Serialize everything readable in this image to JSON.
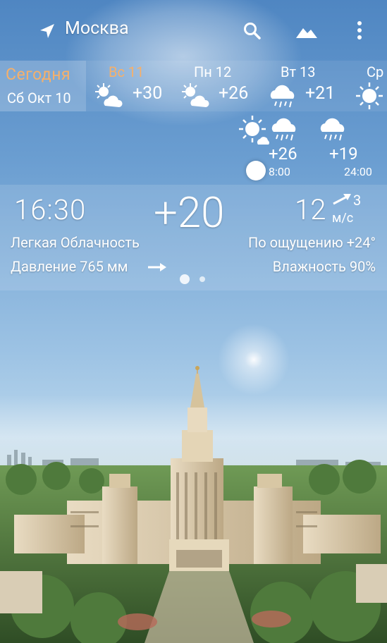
{
  "header": {
    "city": "Москва",
    "location_icon": "location-arrow-icon",
    "search_icon": "search-icon",
    "landscape_icon": "landscape-icon",
    "menu_icon": "more-vert-icon"
  },
  "forecast": {
    "today_label": "Сегодня",
    "today_date": "Сб Окт 10",
    "days": [
      {
        "label": "Вс 11",
        "temp": "+30",
        "icon": "partly-cloudy-icon"
      },
      {
        "label": "Пн 12",
        "temp": "+26",
        "icon": "partly-cloudy-icon"
      },
      {
        "label": "Вт 13",
        "temp": "+21",
        "icon": "rain-icon"
      },
      {
        "label": "Ср",
        "temp": "",
        "icon": "sun-icon"
      }
    ]
  },
  "hourly": [
    {
      "temp": "+26",
      "time": "8:00",
      "icons": [
        "partly-cloudy-icon",
        "rain-icon"
      ]
    },
    {
      "temp": "+19",
      "time": "24:00",
      "icons": [
        "rain-icon"
      ]
    }
  ],
  "current": {
    "time": "16:30",
    "temperature": "+20",
    "wind_speed": "12",
    "wind_gust": "3",
    "wind_unit": "м/с",
    "condition": "Легкая Облачность",
    "feels_like": "По ощущению +24°",
    "pressure": "Давление 765 мм",
    "humidity": "Влажность 90%"
  },
  "pager": {
    "pages": 2,
    "active": 1
  },
  "colors": {
    "accent_today": "#f6b06a",
    "sky": "#6b9ed1"
  }
}
